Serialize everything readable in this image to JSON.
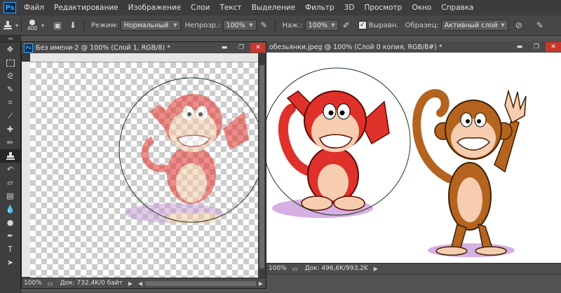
{
  "app": {
    "logo": "Ps"
  },
  "menu": {
    "items": [
      "Файл",
      "Редактирование",
      "Изображение",
      "Слои",
      "Текст",
      "Выделение",
      "Фильтр",
      "3D",
      "Просмотр",
      "Окно",
      "Справка"
    ]
  },
  "options": {
    "brush_size": "400",
    "mode_label": "Режим:",
    "mode_value": "Нормальный",
    "opacity_label": "Непрозр.:",
    "opacity_value": "100%",
    "flow_label": "Наж.:",
    "flow_value": "100%",
    "aligned_label": "Выравн.",
    "aligned_checked": true,
    "sample_label": "Образец:",
    "sample_value": "Активный слой"
  },
  "documents": [
    {
      "title": "Без имени-2 @ 100% (Слой 1, RGB/8) *",
      "zoom": "100%",
      "doc_info": "Док: 732,4K/0 байт"
    },
    {
      "title": "обезьянки.jpeg @ 100% (Слой 0 копия, RGB/8#) *",
      "zoom": "100%",
      "doc_info": "Док: 496,6K/993,2K"
    }
  ],
  "window_buttons": {
    "minimize": "▬",
    "maximize": "❐",
    "close": "✕"
  },
  "colors": {
    "menubar": "#3c3c3c",
    "options": "#474747",
    "workspace": "#535353",
    "accent": "#31a8ff",
    "monkey_red": "#e0302a",
    "monkey_brown": "#b4641e"
  }
}
